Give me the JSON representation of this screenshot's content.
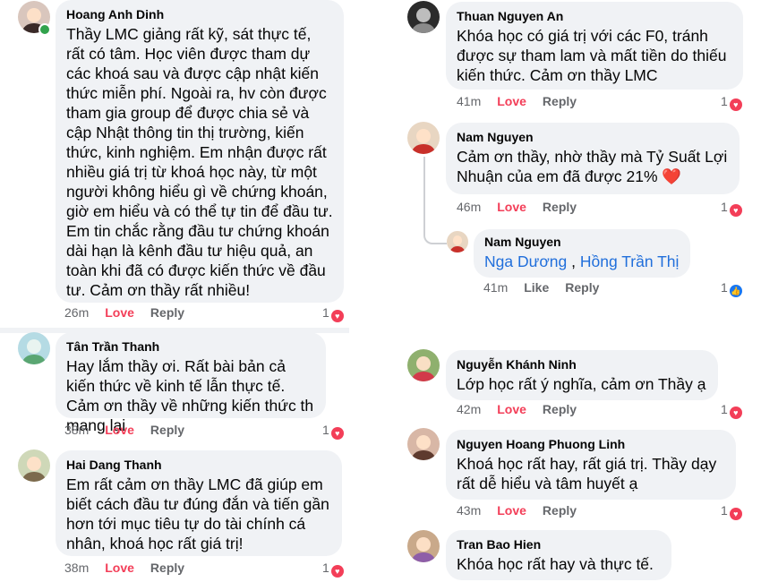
{
  "left": [
    {
      "author": "Hoang Anh Dinh",
      "text": "Thầy LMC giảng rất kỹ, sát thực tế, rất có tâm. Học viên được tham dự các khoá sau  và được cập nhật kiến thức miễn phí. Ngoài ra, hv còn được tham gia group để được chia sẻ và cập Nhật thông tin thị trường, kiến thức, kinh nghiệm. Em nhận được rất nhiều giá trị từ khoá học này, từ một người không hiểu gì về chứng khoán, giờ em hiểu và có thể tự tin để đầu tư. Em tin chắc rằng đầu tư chứng khoán dài hạn là kênh đầu tư hiệu quả, an toàn khi đã có được kiến thức về đầu tư. Cảm ơn thầy rất nhiều!",
      "time": "26m",
      "love": "Love",
      "reply": "Reply",
      "count": "1"
    },
    {
      "author": "Tân Trần Thanh",
      "text": "Hay lắm thầy ơi. Rất bài bản cả kiến thức về kinh tế lẫn thực tế. Cảm ơn thầy về những kiến thức th mang lại",
      "time": "38m",
      "love": "Love",
      "reply": "Reply",
      "count": "1"
    },
    {
      "author": "Hai Dang Thanh",
      "text": "Em rất cảm ơn thầy LMC đã giúp em biết cách đầu tư đúng đắn và tiến gần hơn tới mục tiêu tự do tài chính cá nhân, khoá học rất giá trị!",
      "time": "38m",
      "love": "Love",
      "reply": "Reply",
      "count": "1"
    }
  ],
  "right": [
    {
      "author": "Thuan Nguyen An",
      "text": "Khóa học có giá trị với các F0, tránh được sự tham lam và mất tiền do thiếu kiến thức. Cảm ơn thầy LMC",
      "time": "41m",
      "love": "Love",
      "reply": "Reply",
      "count": "1"
    },
    {
      "author": "Nam Nguyen",
      "text": "Cảm ơn thầy, nhờ thầy mà Tỷ Suất Lợi Nhuận của em đã được 21% ❤️",
      "time": "46m",
      "love": "Love",
      "reply": "Reply",
      "count": "1"
    },
    {
      "author": "Nam Nguyen",
      "mention1": "Nga Dương",
      "separator": " , ",
      "mention2": "Hồng Trần Thị",
      "time": "41m",
      "like": "Like",
      "reply": "Reply",
      "count": "1"
    },
    {
      "author": "Nguyễn Khánh Ninh",
      "text": "Lớp học rất ý nghĩa, cảm ơn Thầy ạ",
      "time": "42m",
      "love": "Love",
      "reply": "Reply",
      "count": "1"
    },
    {
      "author": "Nguyen Hoang Phuong Linh",
      "text": "Khoá học rất hay, rất giá trị. Thầy dạy rất dễ hiểu và tâm huyết ạ",
      "time": "43m",
      "love": "Love",
      "reply": "Reply",
      "count": "1"
    },
    {
      "author": "Tran Bao Hien",
      "text": "Khóa học rất hay và thực tế."
    }
  ],
  "colors": {
    "bubble": "#f0f2f5",
    "love": "#f33e58",
    "mention": "#216fdb",
    "meta": "#65676b",
    "like_icon": "#1877f2"
  }
}
